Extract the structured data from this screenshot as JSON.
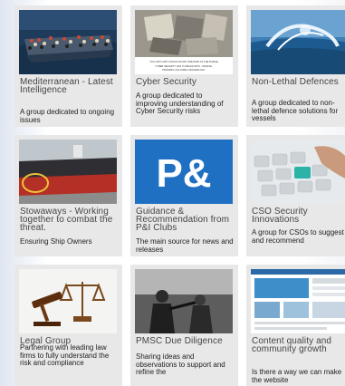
{
  "cards": [
    {
      "title": "Mediterranean - Latest Intelligence",
      "desc": "A group dedicated to ongoing issues",
      "image": "migrant-boat-photo"
    },
    {
      "title": "Cyber Security",
      "desc": "A group dedicated to improving understanding of Cyber Security risks",
      "image": "cyber-security-slide",
      "image_text": "YOU JUST CAN'T FOCUS ON ANY ONE PART OF THE PUZZLE\nCYBER SECURITY HAS TO BE HOLISTIC - PEOPLE, PROCESS, CULTURE & TECHNOLOGY"
    },
    {
      "title": "Non-Lethal Defences",
      "desc": "A group dedicated to non-lethal defence solutions for vessels",
      "image": "water-cannon-photo"
    },
    {
      "title": "Stowaways - Working together to combat the threat.",
      "desc": "Ensuring Ship Owners",
      "image": "ship-hull-photo"
    },
    {
      "title": "Guidance & Recommendation from P&I Clubs",
      "desc": "The main source for news and releases",
      "image": "p-and-i-logo",
      "image_text": "P&"
    },
    {
      "title": "CSO Security Innovations",
      "desc": "A group for CSOs to suggest and recommend",
      "image": "keyboard-photo"
    },
    {
      "title": "Legal Group",
      "desc": "Partnering with leading law firms to fully understand the risk and compliance",
      "image": "gavel-scales-photo"
    },
    {
      "title": "PMSC Due Diligence",
      "desc": "Sharing ideas and observations to support and refine the",
      "image": "security-guards-photo"
    },
    {
      "title": "Content quality and community growth",
      "desc": "Is there a way we can make the website",
      "image": "website-screenshot"
    }
  ]
}
